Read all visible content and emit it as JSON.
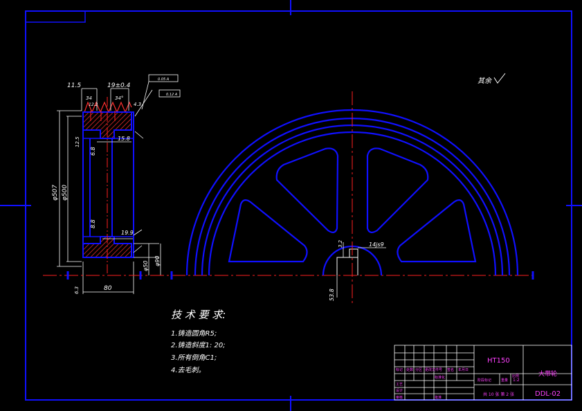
{
  "dimensions": {
    "w11_5": "11.5",
    "w19": "19±0.4",
    "d34": "34",
    "d12_2": "12.2",
    "ang34": "34°",
    "d4_3": "4.3",
    "d6_8": "6.8",
    "d15_8": "15.8",
    "d8_8": "8.8",
    "d19_9": "19.9",
    "dia507": "φ507",
    "dia500": "φ500",
    "dia50": "φ50",
    "dia90": "φ90",
    "w80": "80",
    "key14": "14js9",
    "key53": "53.8",
    "ra63": "6.3",
    "ra32": "3.2",
    "ra12_5": "12.5"
  },
  "tolerance_boxes": [
    "0.05 A",
    "0.12 A"
  ],
  "surface_note": "其余",
  "tech_requirements": {
    "title": "技 术 要 求:",
    "items": [
      "1.铸造圆角R5;",
      "2.铸造斜度1: 20;",
      "3.所有倒角C1;",
      "4.去毛刺。"
    ]
  },
  "title_block": {
    "material": "HT150",
    "part_name": "大带轮",
    "drawing_no": "DDL-02",
    "scale": "1:2",
    "sheet": "共 10 张 第 2 张",
    "labels": [
      "标记",
      "处数",
      "分区",
      "更改文件号",
      "签名",
      "年月日",
      "设计",
      "审核",
      "工艺",
      "批准",
      "标准化",
      "阶段标记",
      "重量",
      "比例"
    ]
  },
  "colors": {
    "background": "#000000",
    "border": "#0000ff",
    "outline": "#1010ff",
    "center_line": "#ff2020",
    "dimension": "#ffffff",
    "title_text": "#ff40ff"
  }
}
